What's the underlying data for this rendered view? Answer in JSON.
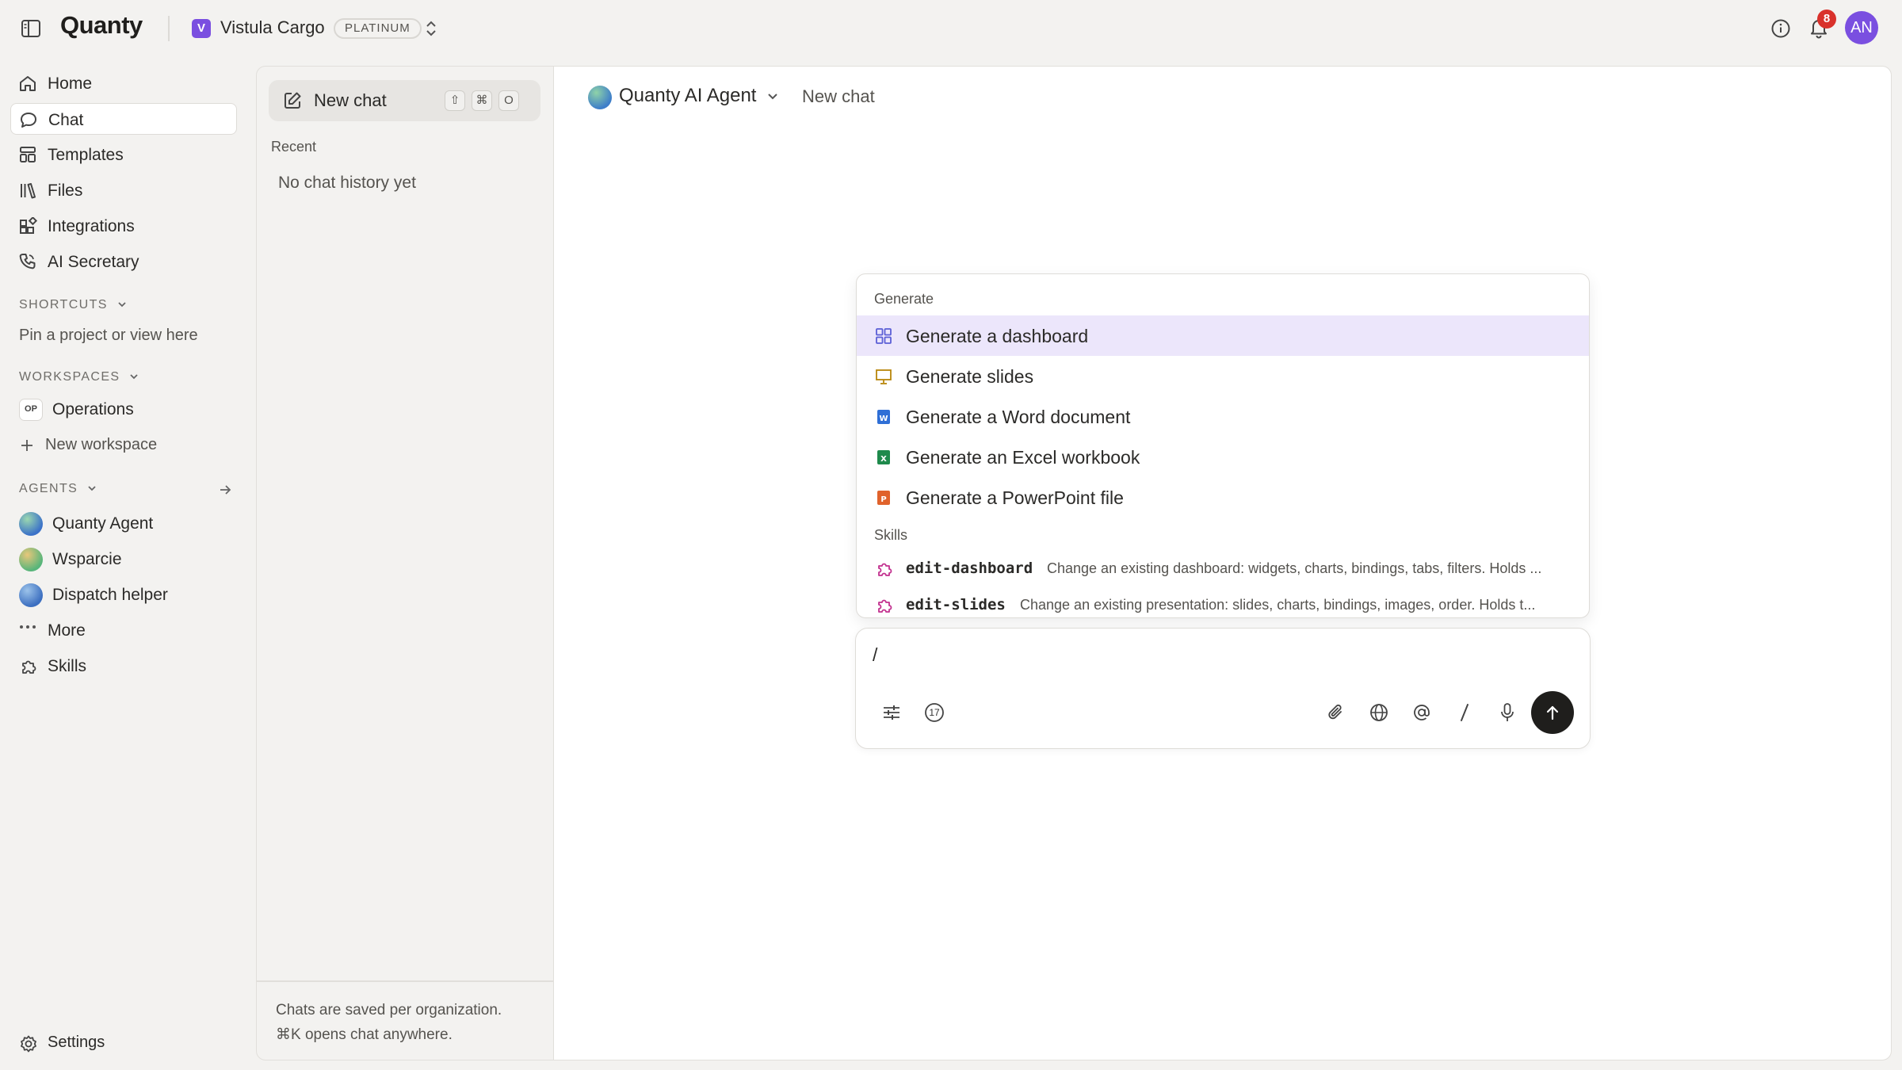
{
  "app": {
    "brand": "Quanty"
  },
  "org": {
    "badge": "V",
    "name": "Vistula Cargo",
    "plan": "PLATINUM"
  },
  "header": {
    "notifications": "8",
    "avatar_initials": "AN"
  },
  "nav": [
    {
      "label": "Home",
      "icon": "home-icon"
    },
    {
      "label": "Chat",
      "icon": "chat-bubble-icon",
      "active": true
    },
    {
      "label": "Templates",
      "icon": "templates-icon"
    },
    {
      "label": "Files",
      "icon": "files-icon"
    },
    {
      "label": "Integrations",
      "icon": "integrations-icon"
    },
    {
      "label": "AI Secretary",
      "icon": "phone-icon"
    }
  ],
  "shortcuts": {
    "heading": "SHORTCUTS",
    "empty": "Pin a project or view here"
  },
  "workspaces": {
    "heading": "WORKSPACES",
    "items": [
      {
        "badge": "OP",
        "label": "Operations"
      }
    ],
    "new_label": "New workspace"
  },
  "agents": {
    "heading": "AGENTS",
    "items": [
      {
        "label": "Quanty Agent"
      },
      {
        "label": "Wsparcie"
      },
      {
        "label": "Dispatch helper"
      }
    ],
    "more_label": "More",
    "skills_label": "Skills"
  },
  "settings_label": "Settings",
  "chat_panel": {
    "new_chat_label": "New chat",
    "shortcut_keys": [
      "⇧",
      "⌘",
      "O"
    ],
    "recent_heading": "Recent",
    "empty_history": "No chat history yet",
    "footer_line1": "Chats are saved per organization.",
    "footer_line2": "⌘K opens chat anywhere."
  },
  "main": {
    "agent_name": "Quanty AI Agent",
    "chat_title": "New chat"
  },
  "menu": {
    "generate_heading": "Generate",
    "generate_items": [
      {
        "label": "Generate a dashboard",
        "icon": "dashboard-grid-icon",
        "highlighted": true
      },
      {
        "label": "Generate slides",
        "icon": "presentation-icon"
      },
      {
        "label": "Generate a Word document",
        "icon": "word-doc-icon"
      },
      {
        "label": "Generate an Excel workbook",
        "icon": "excel-icon"
      },
      {
        "label": "Generate a PowerPoint file",
        "icon": "powerpoint-icon"
      }
    ],
    "skills_heading": "Skills",
    "skills": [
      {
        "name": "edit-dashboard",
        "description": "Change an existing dashboard: widgets, charts, bindings, tabs, filters. Holds ..."
      },
      {
        "name": "edit-slides",
        "description": "Change an existing presentation: slides, charts, bindings, images, order. Holds t..."
      }
    ]
  },
  "composer": {
    "value": "/",
    "badge_number": "17"
  },
  "colors": {
    "accent": "#7a4fe0",
    "highlight": "#ece6fb",
    "badge_red": "#d9312b",
    "send": "#1f1e1c"
  }
}
